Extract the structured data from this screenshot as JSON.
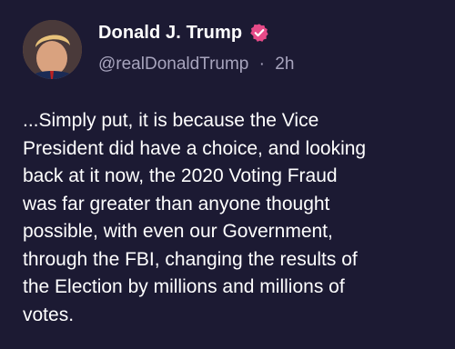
{
  "post": {
    "author_name": "Donald J. Trump",
    "handle": "@realDonaldTrump",
    "separator": "·",
    "time_ago": "2h",
    "verified_icon": "verified-badge-icon",
    "text": "...Simply put, it is because the Vice\nPresident did have a choice, and looking\nback at it now, the 2020 Voting Fraud\nwas far greater than anyone thought\npossible, with even our Government,\nthrough the FBI, changing the results of\nthe Election by millions and millions of\nvotes."
  },
  "colors": {
    "background": "#1c1a33",
    "text": "#ffffff",
    "muted": "#a7a4bd",
    "verified": "#e64a88"
  }
}
